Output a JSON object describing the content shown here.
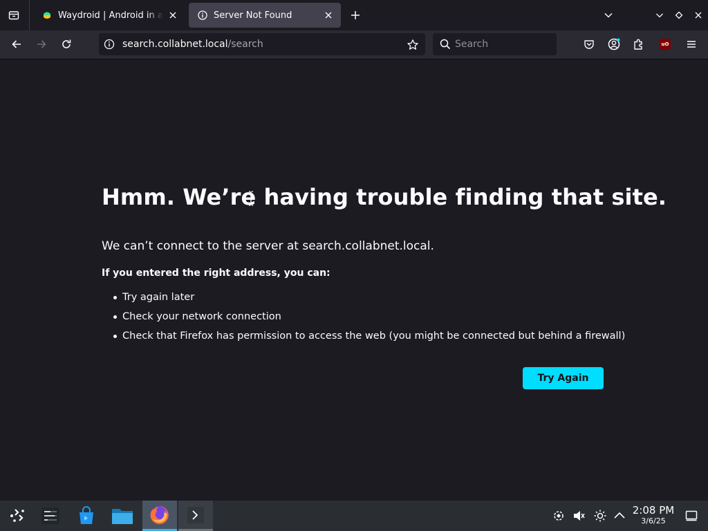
{
  "browser": {
    "tabs": [
      {
        "title": "Waydroid | Android in a Linux container",
        "active": false,
        "favicon": "waydroid-favicon"
      },
      {
        "title": "Server Not Found",
        "active": true,
        "favicon": "info-icon"
      }
    ],
    "url": {
      "host": "search.collabnet.local",
      "path": "/search"
    },
    "search": {
      "placeholder": "Search",
      "value": ""
    }
  },
  "error_page": {
    "title": "Hmm. We’re having trouble finding that site.",
    "subtitle": "We can’t connect to the server at search.collabnet.local.",
    "lead": "If you entered the right address, you can:",
    "suggestions": [
      "Try again later",
      "Check your network connection",
      "Check that Firefox has permission to access the web (you might be connected but behind a firewall)"
    ],
    "try_again_label": "Try Again"
  },
  "taskbar": {
    "clock": {
      "time": "2:08 PM",
      "date": "3/6/25"
    },
    "apps": [
      "app-launcher-icon",
      "task-manager-icon",
      "discover-store-icon",
      "file-manager-icon",
      "firefox-icon",
      "terminal-icon"
    ],
    "tray": [
      "kde-connect-icon",
      "volume-muted-icon",
      "brightness-icon",
      "tray-expand-icon",
      "show-desktop-icon"
    ]
  },
  "colors": {
    "page_bg": "#1c1b22",
    "toolbar_bg": "#2b2a33",
    "active_tab_bg": "#42414d",
    "accent": "#00ddff",
    "taskbar_bg": "#2a2e32",
    "taskbar_highlight": "#3daee9",
    "ublock_red": "#800000"
  }
}
